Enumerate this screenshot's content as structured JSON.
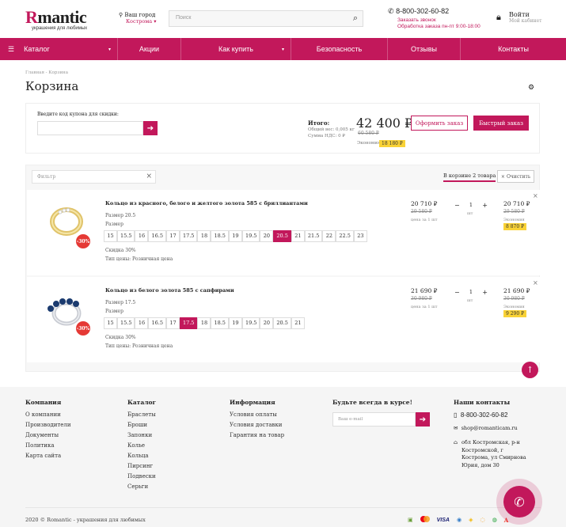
{
  "header": {
    "logo_r": "R",
    "logo_rest": "mantic",
    "tagline": "украшения для любимых",
    "location_label": "Ваш город",
    "location_city": "Кострома",
    "search_placeholder": "Поиск",
    "phone": "8-800-302-60-82",
    "callback_link": "Заказать звонок",
    "hours": "Обработка заказа пн-пт 9:00-18:00",
    "login": "Войти",
    "cabinet": "Мой кабинет"
  },
  "nav": {
    "catalog": "Каталог",
    "items": [
      "Акции",
      "Как купить",
      "Безопасность",
      "Отзывы",
      "Контакты"
    ]
  },
  "breadcrumb": "Главная - Корзина",
  "page_title": "Корзина",
  "coupon": {
    "label": "Введите код купона для скидки:",
    "total_label": "Итого:",
    "weight": "Общий вес: 0,005 кг",
    "vat": "Сумма НДС: 0 ₽",
    "total": "42 400 ₽",
    "old_total": "60 580 ₽",
    "saving_label": "Экономия",
    "saving": "18 180 ₽",
    "checkout": "Оформить заказ",
    "quick_order": "Быстрый заказ"
  },
  "basket": {
    "filter_placeholder": "Фильтр",
    "count_label": "В корзине 2 товара",
    "clear": "Очистить"
  },
  "items": [
    {
      "name": "Кольцо из красного, белого и желтого золота 585 с бриллиантами",
      "size_label": "Размер 20.5",
      "size_header": "Размер",
      "sizes": [
        "15",
        "15.5",
        "16",
        "16.5",
        "17",
        "17.5",
        "18",
        "18.5",
        "19",
        "19.5",
        "20",
        "20.5",
        "21",
        "21.5",
        "22",
        "22.5",
        "23"
      ],
      "active": "20.5",
      "discount_label": "Скидка 30%",
      "price_type": "Тип цены: Розничная цена",
      "badge": "-30%",
      "price": "20 710 ₽",
      "old_price": "29 580 ₽",
      "unit": "цена за 1 шт",
      "qty": "1",
      "qty_unit": "шт",
      "sum": "20 710 ₽",
      "old_sum": "29 580 ₽",
      "saving_label": "Экономия",
      "saving": "8 870 ₽"
    },
    {
      "name": "Кольцо из белого золота 585 с сапфирами",
      "size_label": "Размер 17.5",
      "size_header": "Размер",
      "sizes": [
        "15",
        "15.5",
        "16",
        "16.5",
        "17",
        "17.5",
        "18",
        "18.5",
        "19",
        "19.5",
        "20",
        "20.5",
        "21"
      ],
      "active": "17.5",
      "discount_label": "Скидка 30%",
      "price_type": "Тип цены: Розничная цена",
      "badge": "-30%",
      "price": "21 690 ₽",
      "old_price": "30 980 ₽",
      "unit": "цена за 1 шт",
      "qty": "1",
      "qty_unit": "шт",
      "sum": "21 690 ₽",
      "old_sum": "30 980 ₽",
      "saving_label": "Экономия",
      "saving": "9 290 ₽"
    }
  ],
  "footer": {
    "company": {
      "title": "Компания",
      "links": [
        "О компании",
        "Производители",
        "Документы",
        "Политика",
        "Карта сайта"
      ]
    },
    "catalog": {
      "title": "Каталог",
      "links": [
        "Браслеты",
        "Броши",
        "Запонки",
        "Колье",
        "Кольца",
        "Пирсинг",
        "Подвески",
        "Серьги"
      ]
    },
    "info": {
      "title": "Информация",
      "links": [
        "Условия оплаты",
        "Условия доставки",
        "Гарантия на товар"
      ]
    },
    "subscribe_title": "Будьте всегда в курсе!",
    "email_placeholder": "Ваш e-mail",
    "contacts_title": "Наши контакты",
    "phone": "8-800-302-60-82",
    "email": "shop@romanticam.ru",
    "address": [
      "обл Костромская, р-н",
      "Костромской, г",
      "Кострома, ул Смирнова",
      "Юрия, дом 30"
    ],
    "copyright": "2020 © Romantic - украшения для любимых",
    "payments": [
      "VISA"
    ]
  },
  "colors": {
    "accent": "#c2185b",
    "badge": "#f9d236",
    "discount": "#e53935"
  }
}
